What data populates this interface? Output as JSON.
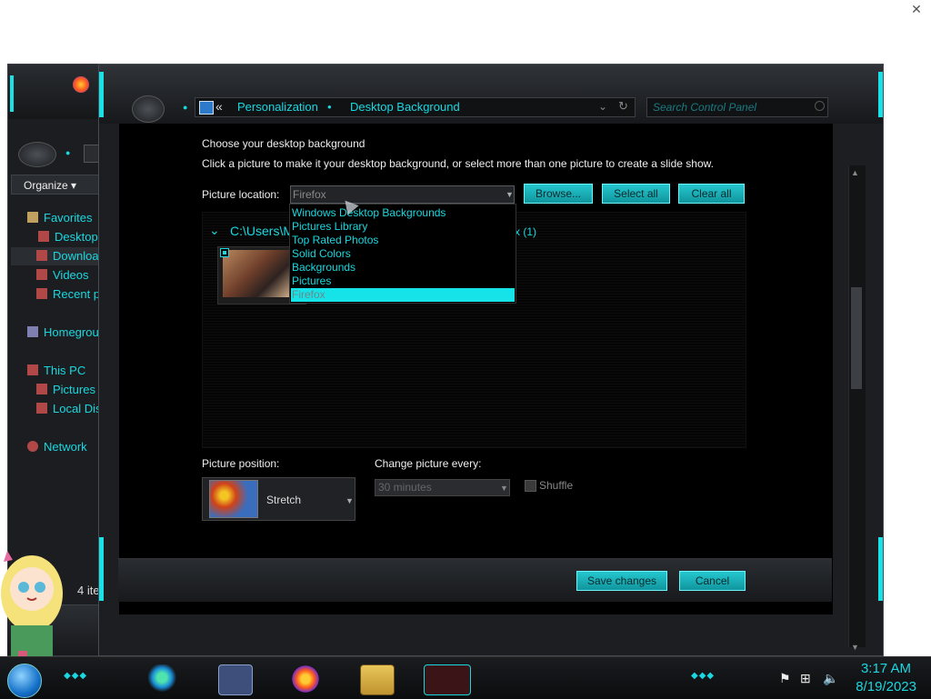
{
  "top_close": "✕",
  "explorer": {
    "organize_label": "Organize ▾",
    "tree": [
      {
        "label": "Favorites",
        "icon": "star-icon",
        "color": "#e0b040"
      },
      {
        "label": "Desktop",
        "icon": "desktop-icon",
        "color": "#c04040"
      },
      {
        "label": "Downloa",
        "icon": "downloads-icon",
        "color": "#c04040"
      },
      {
        "label": "Videos",
        "icon": "videos-icon",
        "color": "#c04040"
      },
      {
        "label": "Recent pl",
        "icon": "recent-places-icon",
        "color": "#c04040"
      },
      {
        "label": "Homegroup",
        "icon": "homegroup-icon",
        "color": "#9090c0"
      },
      {
        "label": "This PC",
        "icon": "computer-icon",
        "color": "#c04040"
      },
      {
        "label": "Pictures",
        "icon": "pictures-icon",
        "color": "#c04040"
      },
      {
        "label": "Local Dis",
        "icon": "local-disk-icon",
        "color": "#c04040"
      },
      {
        "label": "Network",
        "icon": "network-icon",
        "color": "#c04040"
      }
    ],
    "status_count": "4 ite"
  },
  "control_panel": {
    "breadcrumb_back": "«",
    "breadcrumb": [
      "Personalization",
      "Desktop Background"
    ],
    "breadcrumb_sep": "●",
    "search_placeholder": "Search Control Panel",
    "title": "Choose your desktop background",
    "subtitle": "Click a picture to make it your desktop background, or select more than one picture to create a slide show.",
    "picture_location_label": "Picture location:",
    "picture_location_value": "Firefox",
    "browse_label": "Browse...",
    "select_all_label": "Select all",
    "clear_all_label": "Clear all",
    "location_options": [
      "Windows Desktop Backgrounds",
      "Pictures Library",
      "Top Rated Photos",
      "Solid Colors",
      "Backgrounds",
      "Pictures",
      "Firefox"
    ],
    "selected_option": "Firefox",
    "folder_path": "C:\\Users\\M",
    "folder_count": "x (1)",
    "picture_position_label": "Picture position:",
    "picture_position_value": "Stretch",
    "change_every_label": "Change picture every:",
    "change_every_value": "30 minutes",
    "shuffle_label": "Shuffle",
    "save_label": "Save changes",
    "cancel_label": "Cancel"
  },
  "taskbar": {
    "time": "3:17 AM",
    "date": "8/19/2023"
  },
  "colors": {
    "accent": "#19d8e0",
    "background": "#000000",
    "button": "#1bb9c1"
  }
}
